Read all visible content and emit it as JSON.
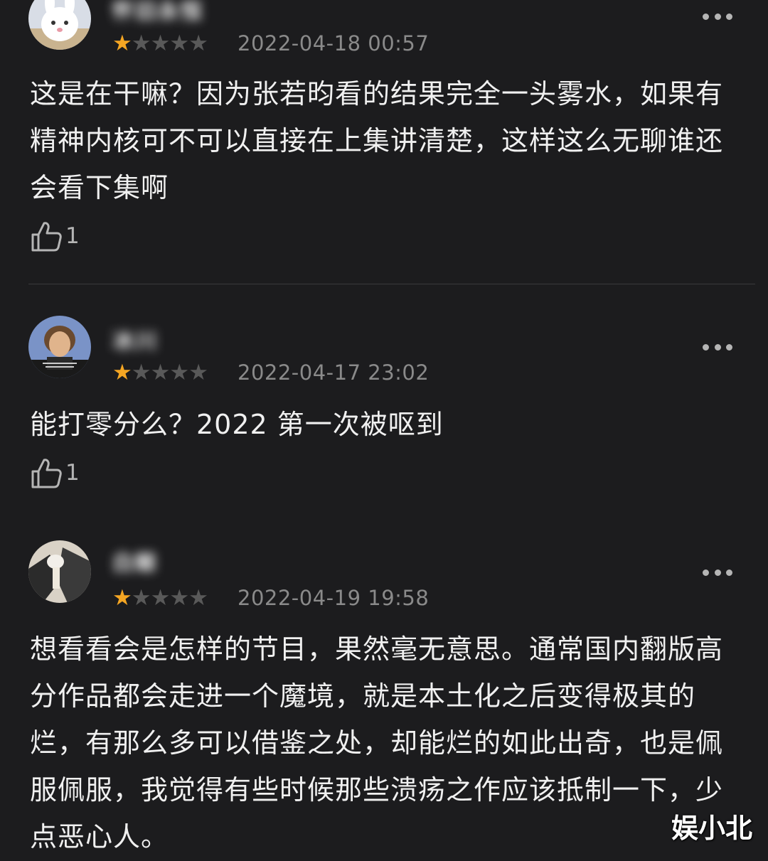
{
  "reviews": [
    {
      "username": "怀旧永恒",
      "rating": 1,
      "rating_max": 5,
      "date": "2022-04-18 00:57",
      "content": "这是在干嘛？因为张若昀看的结果完全一头雾水，如果有精神内核可不可以直接在上集讲清楚，这样这么无聊谁还会看下集啊",
      "likes": "1",
      "avatar_icon": "bunny-avatar-icon"
    },
    {
      "username": "冰川",
      "rating": 1,
      "rating_max": 5,
      "date": "2022-04-17 23:02",
      "content": "能打零分么？2022 第一次被呕到",
      "likes": "1",
      "avatar_icon": "portrait-avatar-icon"
    },
    {
      "username": "白鲸",
      "rating": 1,
      "rating_max": 5,
      "date": "2022-04-19 19:58",
      "content": "想看看会是怎样的节目，果然毫无意思。通常国内翻版高分作品都会走进一个魔境，就是本土化之后变得极其的烂，有那么多可以借鉴之处，却能烂的如此出奇，也是佩服佩服，我觉得有些时候那些溃疡之作应该抵制一下，少点恶心人。",
      "likes": "",
      "avatar_icon": "photo-avatar-icon"
    }
  ],
  "watermark": "娱小北",
  "colors": {
    "background": "#1c1c1e",
    "star_on": "#f5a623",
    "star_off": "#595959",
    "text": "#f0f0f0",
    "meta": "#8a8a8a"
  },
  "icons": {
    "like": "thumbs-up-icon",
    "more": "more-dots-icon",
    "star": "star-icon"
  }
}
